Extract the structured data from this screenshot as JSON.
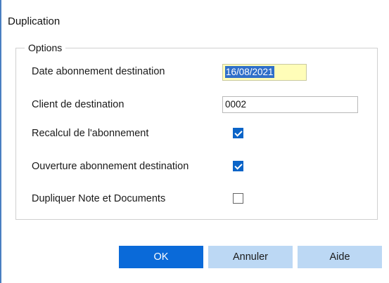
{
  "dialog": {
    "title": "Duplication"
  },
  "options": {
    "legend": "Options",
    "date_label": "Date abonnement destination",
    "date_value": "16/08/2021",
    "client_label": "Client de destination",
    "client_value": "0002",
    "recalcul_label": "Recalcul de l'abonnement",
    "recalcul_checked": true,
    "ouverture_label": "Ouverture abonnement destination",
    "ouverture_checked": true,
    "dupliquer_label": "Dupliquer Note et Documents",
    "dupliquer_checked": false
  },
  "buttons": {
    "ok": "OK",
    "cancel": "Annuler",
    "help": "Aide"
  },
  "colors": {
    "accent": "#0a6ad9",
    "secondary": "#bcd8f4",
    "date_bg": "#fffdb8"
  }
}
